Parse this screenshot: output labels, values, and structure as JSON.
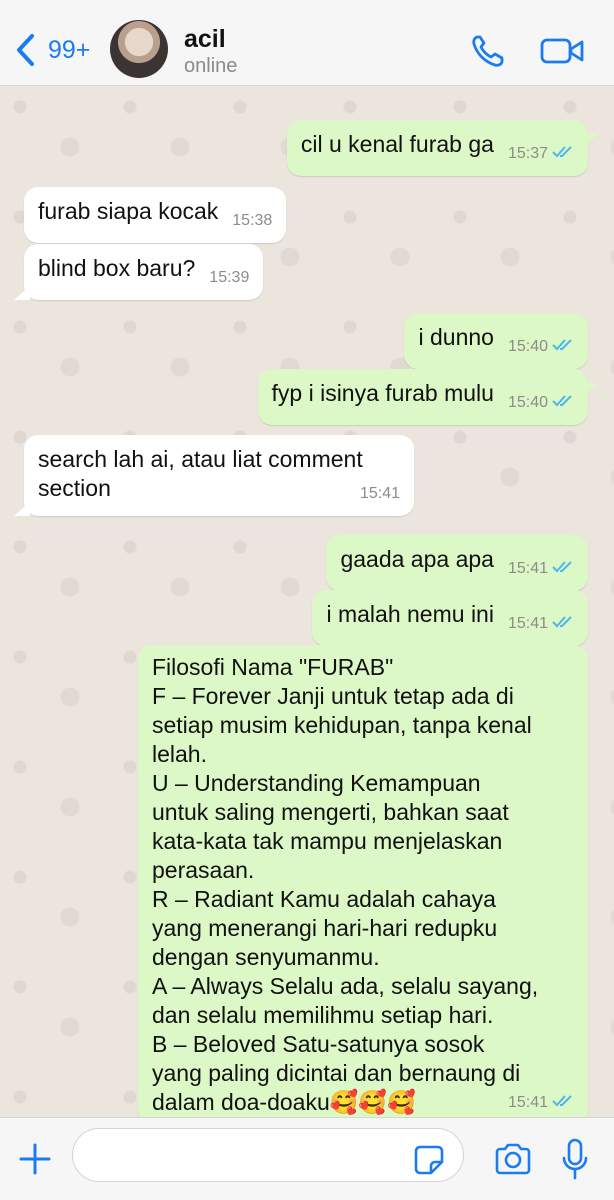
{
  "header": {
    "back_badge": "99+",
    "contact_name": "acil",
    "contact_status": "online"
  },
  "colors": {
    "accent": "#1a7cf0",
    "outgoing_bubble": "#dcf8c6",
    "incoming_bubble": "#ffffff",
    "read_ticks": "#4fb6ec"
  },
  "messages": [
    {
      "direction": "out",
      "text": "cil u kenal furab ga",
      "time": "15:37",
      "read": true
    },
    {
      "direction": "in",
      "text": "furab siapa kocak",
      "time": "15:38"
    },
    {
      "direction": "in",
      "text": "blind box baru?",
      "time": "15:39"
    },
    {
      "direction": "out",
      "text": "i dunno",
      "time": "15:40",
      "read": true
    },
    {
      "direction": "out",
      "text": "fyp i isinya furab mulu",
      "time": "15:40",
      "read": true
    },
    {
      "direction": "in",
      "text": "search lah ai, atau liat comment\nsection",
      "time": "15:41"
    },
    {
      "direction": "out",
      "text": "gaada apa apa",
      "time": "15:41",
      "read": true
    },
    {
      "direction": "out",
      "text": "i malah nemu ini",
      "time": "15:41",
      "read": true
    },
    {
      "direction": "out",
      "text": "Filosofi Nama \"FURAB\"\nF – Forever Janji untuk tetap ada di\nsetiap musim kehidupan, tanpa kenal\nlelah.\nU – Understanding Kemampuan\nuntuk saling mengerti, bahkan saat\nkata-kata tak mampu menjelaskan\nperasaan.\nR – Radiant Kamu adalah cahaya\nyang menerangi hari-hari redupku\ndengan senyumanmu.\nA – Always Selalu ada, selalu sayang,\ndan selalu memilihmu setiap hari.\nB – Beloved Satu-satunya sosok\nyang paling dicintai dan bernaung di\ndalam doa-doaku🥰🥰🥰",
      "time": "15:41",
      "read": true
    }
  ],
  "icons": {
    "back": "chevron-left-icon",
    "call": "phone-icon",
    "video": "video-camera-icon",
    "plus": "plus-icon",
    "sticker": "sticker-icon",
    "camera": "camera-icon",
    "mic": "microphone-icon"
  }
}
